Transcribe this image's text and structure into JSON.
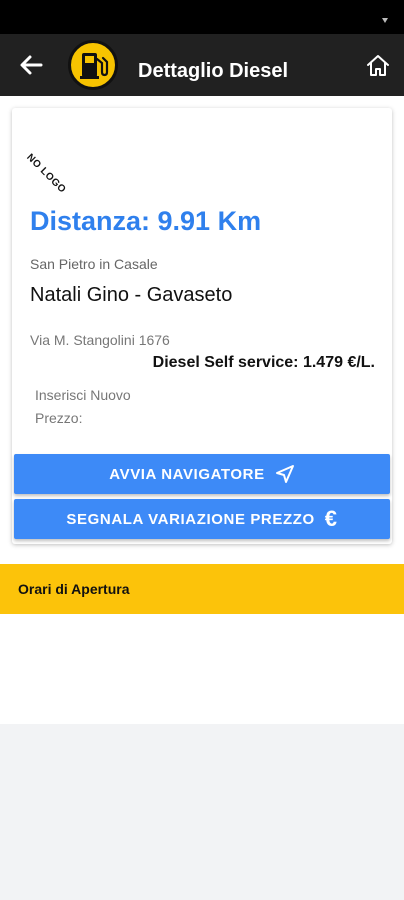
{
  "header": {
    "title": "Dettaglio Diesel",
    "back_icon": "arrow-left-icon",
    "logo_icon": "fuel-pump-icon",
    "home_icon": "home-icon"
  },
  "station": {
    "logo_placeholder": "NO LOGO",
    "distance": "Distanza: 9.91 Km",
    "city": "San Pietro in Casale",
    "name": "Natali Gino - Gavaseto",
    "address": "Via M. Stangolini 1676",
    "price": "Diesel Self service: 1.479 €/L.",
    "new_price_label": "Inserisci Nuovo Prezzo:"
  },
  "actions": {
    "navigate_label": "AVVIA NAVIGATORE",
    "navigate_icon": "navigation-arrow-icon",
    "report_label": "SEGNALA VARIAZIONE PREZZO",
    "report_icon_glyph": "€"
  },
  "hours": {
    "label": "Orari di Apertura"
  },
  "colors": {
    "accent": "#3d8af7",
    "distance": "#2f80ed",
    "hours_bar": "#fcc30a",
    "app_bar": "#212121"
  }
}
